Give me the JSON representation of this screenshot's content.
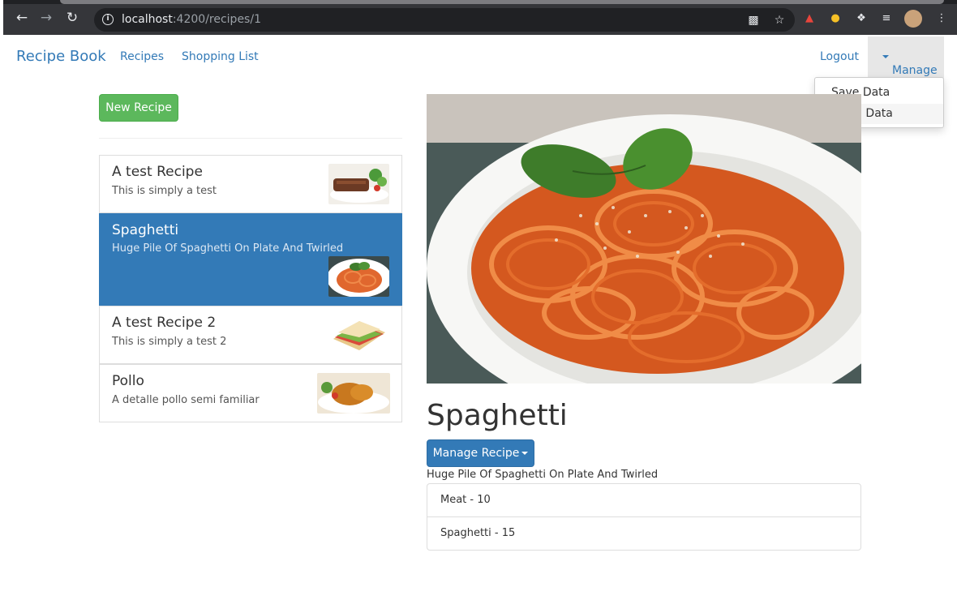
{
  "browser": {
    "url_host": "localhost",
    "url_path": ":4200/recipes/1"
  },
  "navbar": {
    "brand": "Recipe Book",
    "links": [
      "Recipes",
      "Shopping List"
    ],
    "logout": "Logout",
    "manage": "Manage",
    "manage_menu": [
      "Save Data",
      "Fetch Data"
    ]
  },
  "sidebar": {
    "new_recipe_label": "New Recipe",
    "recipes": [
      {
        "name": "A test Recipe",
        "description": "This is simply a test",
        "active": false
      },
      {
        "name": "Spaghetti",
        "description": "Huge Pile Of Spaghetti On Plate And Twirled",
        "active": true
      },
      {
        "name": "A test Recipe 2",
        "description": "This is simply a test 2",
        "active": false
      },
      {
        "name": "Pollo",
        "description": "A detalle pollo semi familiar",
        "active": false
      }
    ]
  },
  "detail": {
    "name": "Spaghetti",
    "manage_button": "Manage Recipe",
    "description": "Huge Pile Of Spaghetti On Plate And Twirled",
    "ingredients": [
      "Meat - 10",
      "Spaghetti - 15"
    ]
  },
  "colors": {
    "primary": "#337ab7",
    "success": "#5cb85c",
    "chrome": "#35363a"
  }
}
